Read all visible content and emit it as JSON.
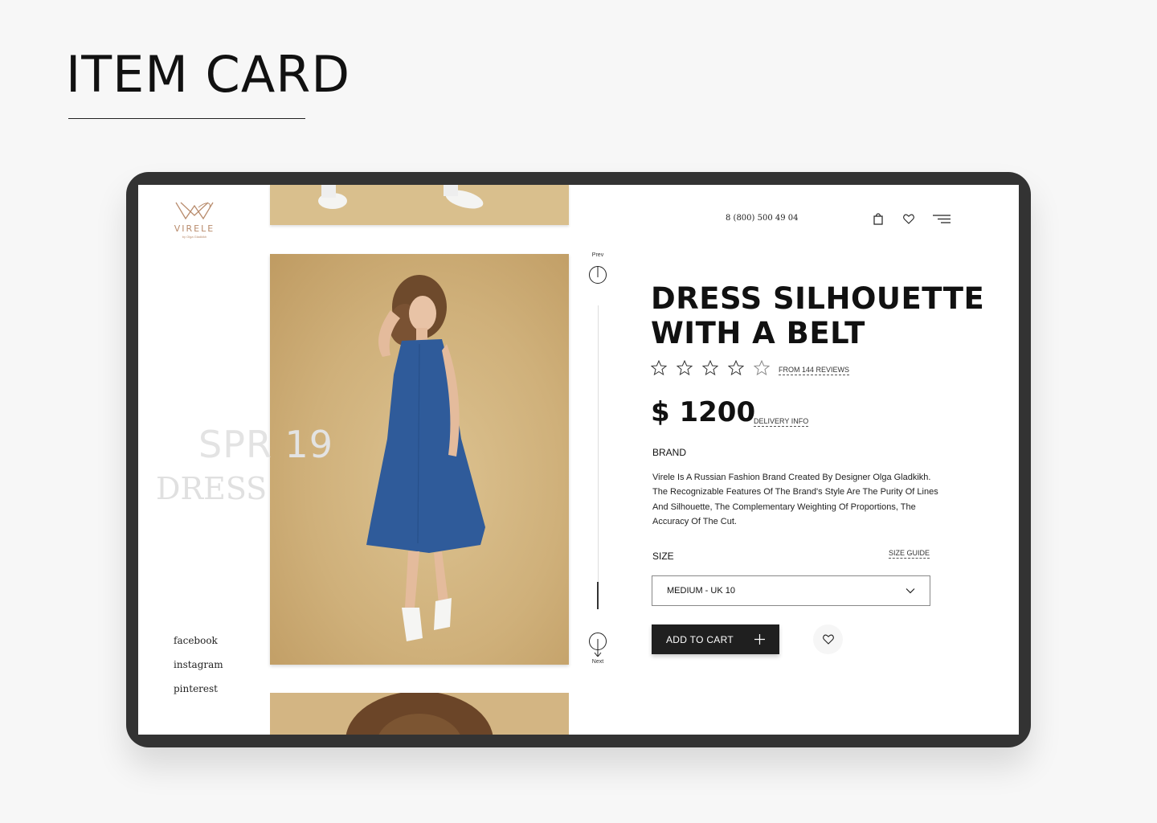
{
  "page": {
    "heading": "ITEM CARD"
  },
  "logo": {
    "name": "VIRELE",
    "tagline": "by Olga Gladkikh",
    "icon": "virele-logo-icon",
    "color": "#b88b6c"
  },
  "header": {
    "phone": "8 (800) 500 49 04",
    "icons": [
      "bag-icon",
      "heart-icon",
      "menu-icon"
    ]
  },
  "side": {
    "season": "SPR 19",
    "category": "DRESS"
  },
  "social": [
    "facebook",
    "instagram",
    "pinterest"
  ],
  "gallery": {
    "prev_label": "Prev",
    "next_label": "Next",
    "progress": 0.9
  },
  "product": {
    "title": "DRESS SILHOUETTE WITH A BELT",
    "rating": 0,
    "rating_max": 5,
    "reviews_link": "FROM 144 REVIEWS",
    "price": "$ 1200",
    "delivery_link": "DELIVERY INFO",
    "brand_label": "BRAND",
    "brand_description": "Virele Is A Russian Fashion Brand Created By Designer Olga Gladkikh. The Recognizable Features Of The Brand's Style Are The Purity Of Lines And Silhouette, The Complementary Weighting Of Proportions, The Accuracy Of The Cut.",
    "size_label": "SIZE",
    "size_guide": "SIZE GUIDE",
    "size_selected": "MEDIUM - UK 10",
    "add_to_cart": "ADD TO CART"
  },
  "colors": {
    "accent": "#1f1f1f",
    "photo_bg": "#cfb07a",
    "dress": "#2f5b9a"
  }
}
